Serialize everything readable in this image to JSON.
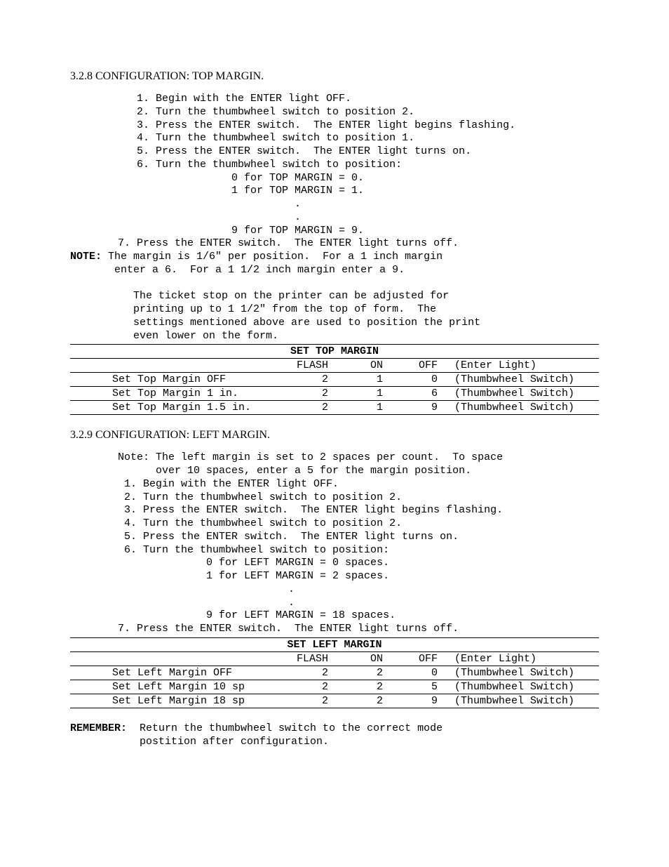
{
  "sections": {
    "top": {
      "heading": "3.2.8  CONFIGURATION:   TOP MARGIN.",
      "steps": "     1. Begin with the ENTER light OFF.\n     2. Turn the thumbwheel switch to position 2.\n     3. Press the ENTER switch.  The ENTER light begins flashing.\n     4. Turn the thumbwheel switch to position 1.\n     5. Press the ENTER switch.  The ENTER light turns on.\n     6. Turn the thumbwheel switch to position:\n                    0 for TOP MARGIN = 0.\n                    1 for TOP MARGIN = 1.\n                              .\n                              .\n                    9 for TOP MARGIN = 9.\n  7. Press the ENTER switch.  The ENTER light turns off.",
      "note_label": "NOTE:",
      "note_text": " The margin is 1/6\" per position.  For a 1 inch margin\n       enter a 6.  For a 1 1/2 inch margin enter a 9.\n\n          The ticket stop on the printer can be adjusted for\n          printing up to 1 1/2\" from the top of form.  The\n          settings mentioned above are used to position the print\n          even lower on the form.",
      "table": {
        "title": "SET TOP MARGIN",
        "header": {
          "c1": "",
          "c2": "FLASH",
          "c3": "ON",
          "c4": "OFF",
          "c5": "(Enter Light)"
        },
        "rows": [
          {
            "label": "Set Top Margin OFF",
            "f": "2",
            "on": "1",
            "off": "0",
            "note": "(Thumbwheel Switch)"
          },
          {
            "label": "Set Top Margin 1 in.",
            "f": "2",
            "on": "1",
            "off": "6",
            "note": "(Thumbwheel Switch)"
          },
          {
            "label": "Set Top Margin 1.5 in.",
            "f": "2",
            "on": "1",
            "off": "9",
            "note": "(Thumbwheel Switch)"
          }
        ]
      }
    },
    "left": {
      "heading": "3.2.9  CONFIGURATION:   LEFT MARGIN.",
      "steps": "  Note: The left margin is set to 2 spaces per count.  To space\n        over 10 spaces, enter a 5 for the margin position.\n   1. Begin with the ENTER light OFF.\n   2. Turn the thumbwheel switch to position 2.\n   3. Press the ENTER switch.  The ENTER light begins flashing.\n   4. Turn the thumbwheel switch to position 2.\n   5. Press the ENTER switch.  The ENTER light turns on.\n   6. Turn the thumbwheel switch to position:\n                0 for LEFT MARGIN = 0 spaces.\n                1 for LEFT MARGIN = 2 spaces.\n                             .\n                             .\n                9 for LEFT MARGIN = 18 spaces.\n  7. Press the ENTER switch.  The ENTER light turns off.",
      "table": {
        "title": "SET LEFT MARGIN",
        "header": {
          "c1": "",
          "c2": "FLASH",
          "c3": "ON",
          "c4": "OFF",
          "c5": "(Enter Light)"
        },
        "rows": [
          {
            "label": "Set Left Margin OFF",
            "f": "2",
            "on": "2",
            "off": "0",
            "note": "(Thumbwheel Switch)"
          },
          {
            "label": "Set Left Margin 10 sp",
            "f": "2",
            "on": "2",
            "off": "5",
            "note": "(Thumbwheel Switch)"
          },
          {
            "label": "Set Left Margin 18 sp",
            "f": "2",
            "on": "2",
            "off": "9",
            "note": "(Thumbwheel Switch)"
          }
        ]
      }
    }
  },
  "remember_label": "REMEMBER:",
  "remember_text": "  Return the thumbwheel switch to the correct mode\n           postition after configuration."
}
